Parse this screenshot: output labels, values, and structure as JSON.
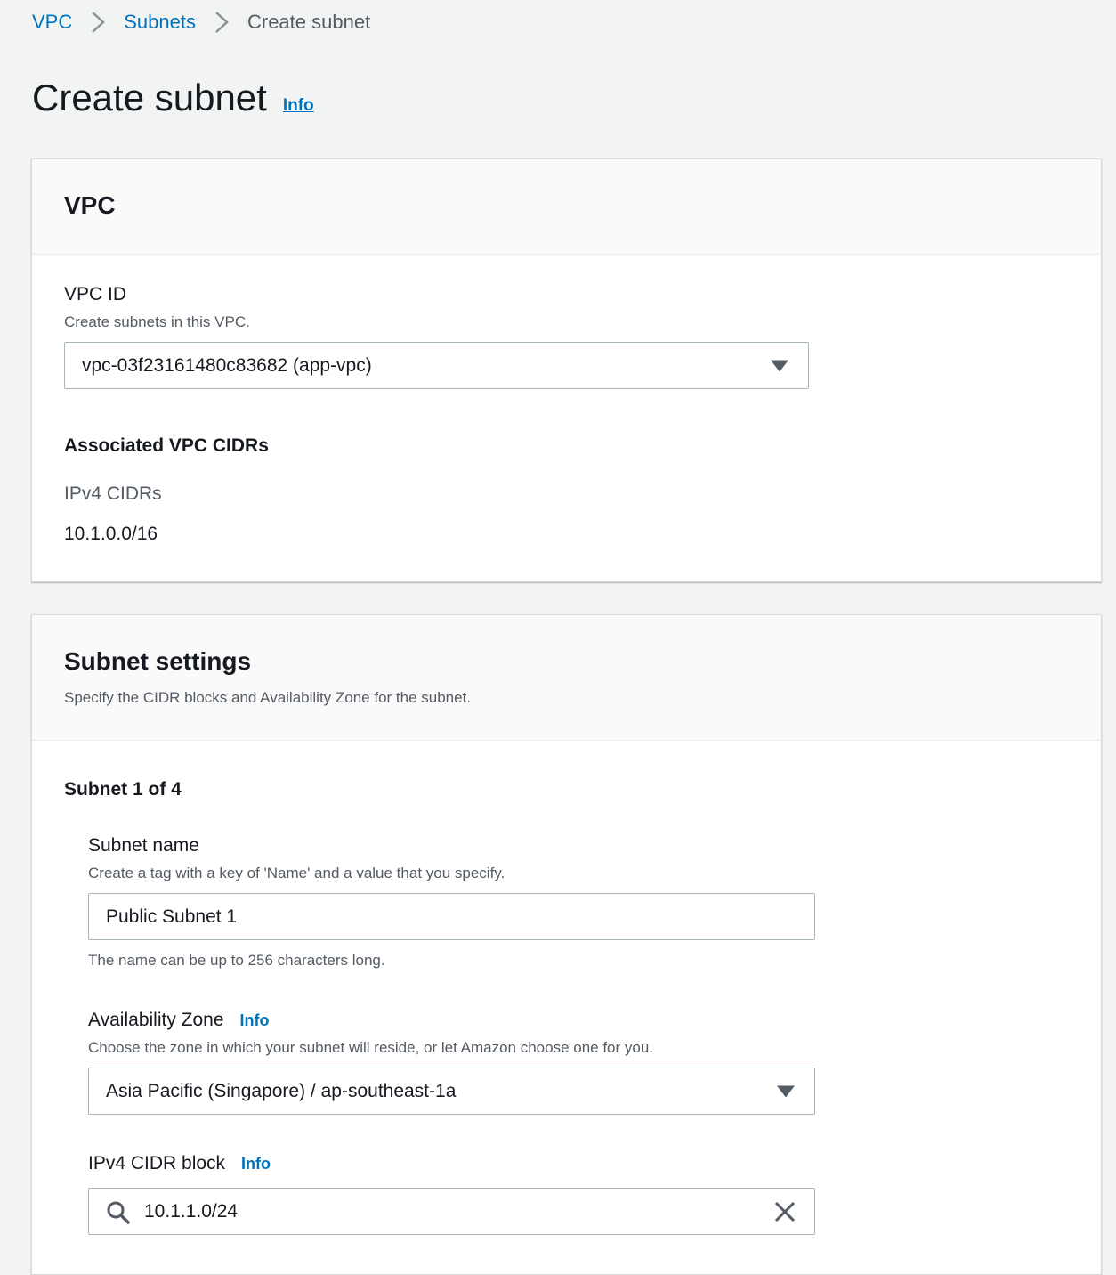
{
  "breadcrumb": {
    "items": [
      "VPC",
      "Subnets"
    ],
    "current": "Create subnet"
  },
  "page": {
    "title": "Create subnet",
    "info": "Info"
  },
  "vpc_panel": {
    "title": "VPC",
    "vpc_id_label": "VPC ID",
    "vpc_id_desc": "Create subnets in this VPC.",
    "vpc_id_value": "vpc-03f23161480c83682 (app-vpc)",
    "cidrs_heading": "Associated VPC CIDRs",
    "ipv4_label": "IPv4 CIDRs",
    "ipv4_value": "10.1.0.0/16"
  },
  "subnet_panel": {
    "title": "Subnet settings",
    "desc": "Specify the CIDR blocks and Availability Zone for the subnet.",
    "subnet_heading": "Subnet 1 of 4",
    "name_label": "Subnet name",
    "name_desc": "Create a tag with a key of 'Name' and a value that you specify.",
    "name_value": "Public Subnet 1",
    "name_hint": "The name can be up to 256 characters long.",
    "az_label": "Availability Zone",
    "az_info": "Info",
    "az_desc": "Choose the zone in which your subnet will reside, or let Amazon choose one for you.",
    "az_value": "Asia Pacific (Singapore) / ap-southeast-1a",
    "cidr_label": "IPv4 CIDR block",
    "cidr_info": "Info",
    "cidr_value": "10.1.1.0/24"
  },
  "colors": {
    "link": "#0073bb",
    "text": "#16191f",
    "secondary_text": "#545b64",
    "background": "#f2f3f3",
    "border": "#aab7b8"
  }
}
